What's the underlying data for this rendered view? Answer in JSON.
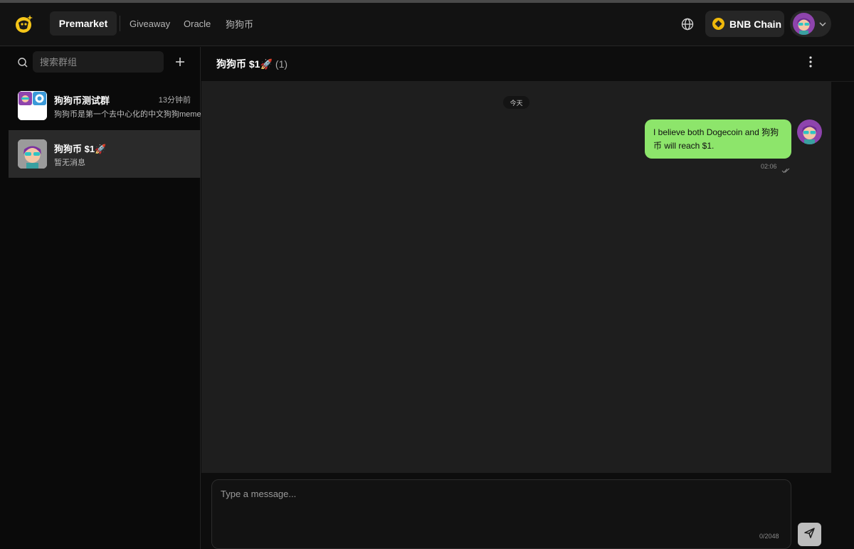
{
  "header": {
    "nav": {
      "premarket": "Premarket",
      "giveaway": "Giveaway",
      "oracle": "Oracle",
      "dogcoin": "狗狗币"
    },
    "chain_label": "BNB Chain"
  },
  "sidebar": {
    "search_placeholder": "搜索群组",
    "groups": [
      {
        "name": "狗狗币测试群",
        "time": "13分钟前",
        "preview": "狗狗币是第一个去中心化的中文狗狗meme"
      },
      {
        "name": "狗狗币 $1🚀",
        "time": "",
        "preview": "暂无消息"
      }
    ]
  },
  "chat": {
    "title": "狗狗币 $1🚀",
    "member_count": "(1)",
    "date_label": "今天",
    "messages": [
      {
        "text": "I believe both Dogecoin and 狗狗币 will reach $1.",
        "time": "02:06"
      }
    ],
    "composer_placeholder": "Type a message...",
    "char_count": "0/2048"
  },
  "colors": {
    "bubble": "#8de56b",
    "bnb_accent": "#f0b90b",
    "logo_yellow": "#f5c518"
  }
}
